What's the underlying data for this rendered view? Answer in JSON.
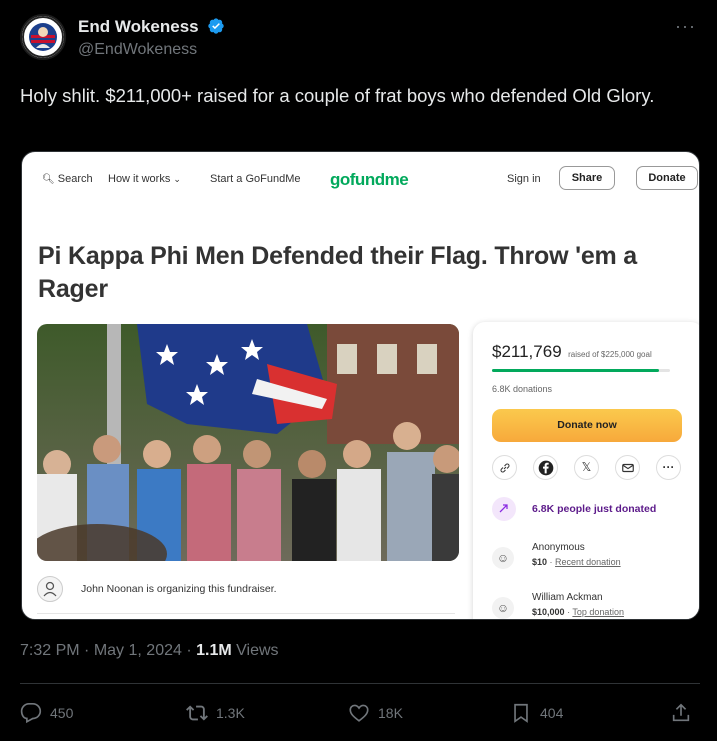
{
  "post": {
    "author_name": "End Wokeness",
    "handle": "@EndWokeness",
    "more_icon": "more-horizontal-icon",
    "text": "Holy shlit. $211,000+ raised for a couple of frat boys who defended Old Glory.",
    "avatar_text_top": "LOADED",
    "avatar_text_bottom": "WOKE"
  },
  "card": {
    "nav": {
      "search": "Search",
      "how_it_works": "How it works",
      "start": "Start a GoFundMe",
      "logo": "gofundme",
      "sign_in": "Sign in",
      "share": "Share",
      "donate": "Donate"
    },
    "campaign_title": "Pi Kappa Phi Men Defended their Flag. Throw 'em a Rager",
    "organizer": "John Noonan is organizing this fundraiser.",
    "panel": {
      "raised": "$211,769",
      "goal": "raised of $225,000 goal",
      "progress_fraction": 0.941,
      "donations": "6.8K donations",
      "donate_now": "Donate now",
      "recent_people": "6.8K people just donated",
      "donors": [
        {
          "name": "Anonymous",
          "amount": "$10",
          "tag": "Recent donation"
        },
        {
          "name": "William Ackman",
          "amount": "$10,000",
          "tag": "Top donation"
        }
      ]
    },
    "colors": {
      "brand_green": "#02a95c",
      "donate_button": "#f7a93b"
    }
  },
  "meta": {
    "time": "7:32 PM",
    "date": "May 1, 2024",
    "views_count": "1.1M",
    "views_label": "Views"
  },
  "actions": {
    "replies": "450",
    "reposts": "1.3K",
    "likes": "18K",
    "bookmarks": "404"
  }
}
